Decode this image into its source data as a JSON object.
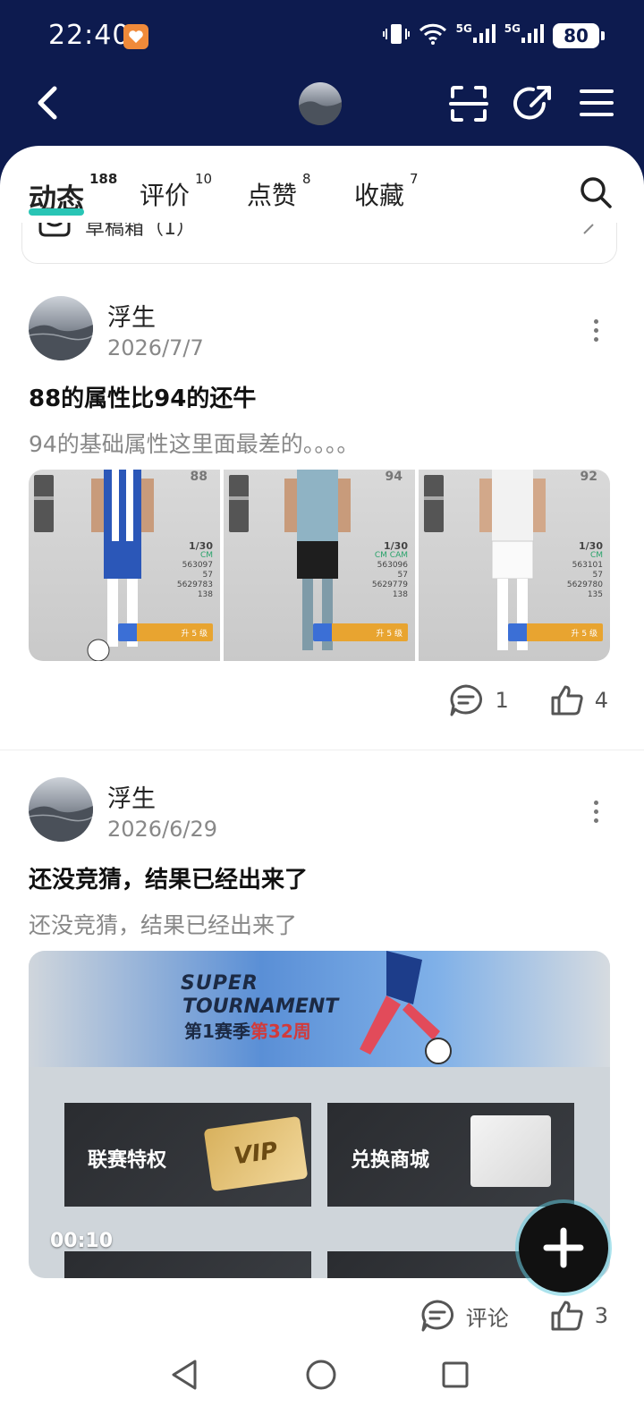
{
  "status_bar": {
    "time": "22:40",
    "signal_1_label": "5G",
    "signal_2_label": "5G",
    "battery": "80"
  },
  "tabs": [
    {
      "label": "动态",
      "count": "188"
    },
    {
      "label": "评价",
      "count": "10"
    },
    {
      "label": "点赞",
      "count": "8"
    },
    {
      "label": "收藏",
      "count": "7"
    }
  ],
  "peek_item": {
    "text": "草稿箱（1）"
  },
  "posts": [
    {
      "author": "浮生",
      "date": "2026/7/7",
      "title": "88的属性比94的还牛",
      "body": "94的基础属性这里面最差的。。。。",
      "images": [
        {
          "rating": "88",
          "level": "1/30",
          "position": "CM",
          "s1": "563097",
          "s2": "57",
          "s3": "5629783",
          "s4": "138",
          "upgrade": "升 5 级"
        },
        {
          "rating": "94",
          "level": "1/30",
          "position": "CM CAM",
          "s1": "563096",
          "s2": "57",
          "s3": "5629779",
          "s4": "138",
          "upgrade": "升 5 级"
        },
        {
          "rating": "92",
          "level": "1/30",
          "position": "CM",
          "s1": "563101",
          "s2": "57",
          "s3": "5629780",
          "s4": "135",
          "upgrade": "升 5 级"
        }
      ],
      "comments": "1",
      "likes": "4"
    },
    {
      "author": "浮生",
      "date": "2026/6/29",
      "title": "还没竞猜，结果已经出来了",
      "body": "还没竞猜，结果已经出来了",
      "video": {
        "banner_line1": "SUPER",
        "banner_line2": "TOURNAMENT",
        "season_prefix": "第1赛季",
        "season_week": "第32周",
        "tile1_label": "联赛特权",
        "tile2_label": "兑换商城",
        "vip_text": "VIP",
        "duration": "00:10"
      },
      "comments": "评论",
      "likes": "3"
    }
  ],
  "colors": {
    "header": "#0d1b4f",
    "accent": "#29c5b5"
  }
}
